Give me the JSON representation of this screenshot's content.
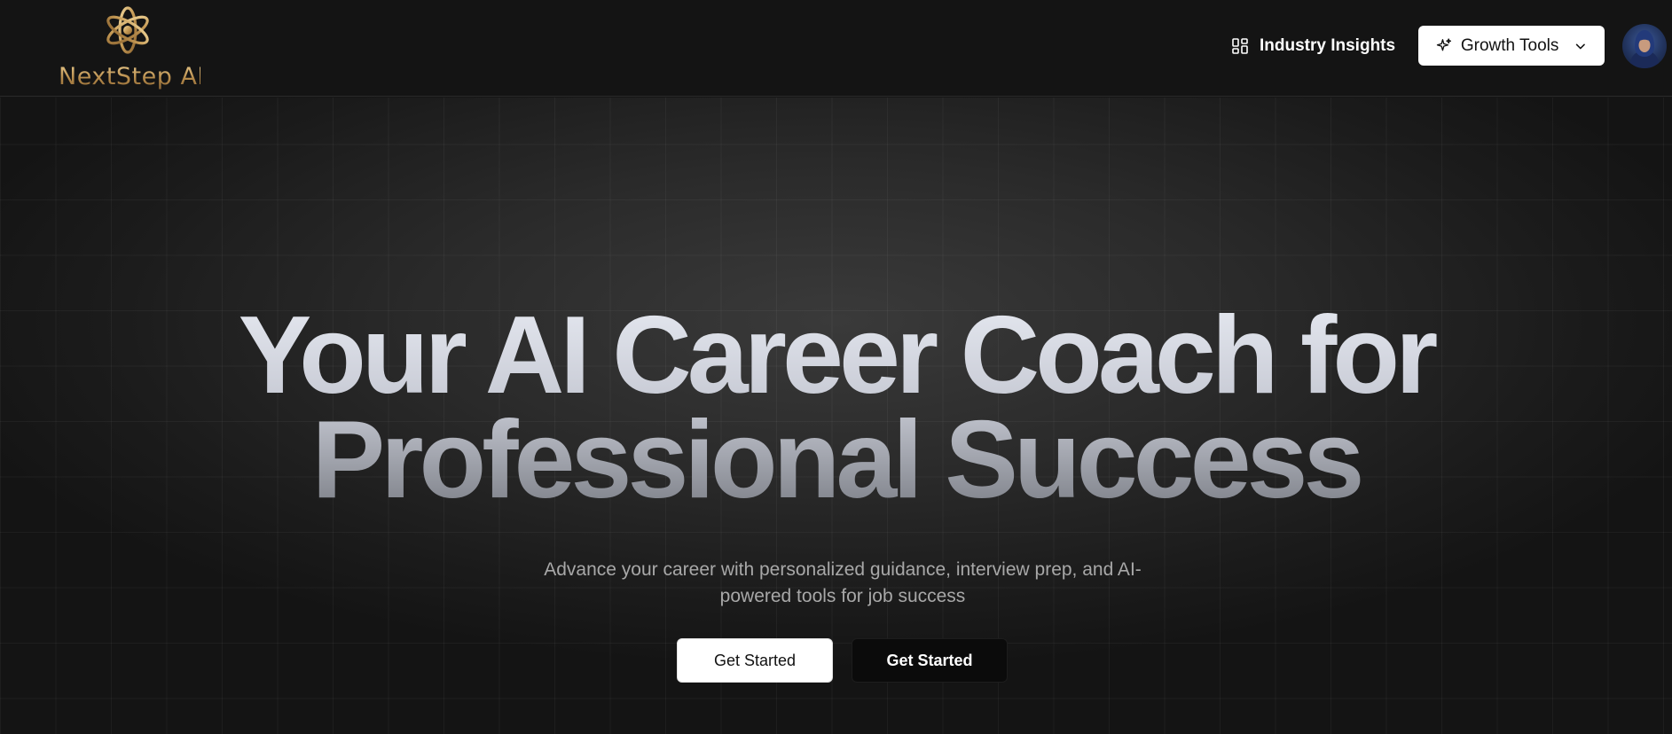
{
  "header": {
    "brand": "NextStep AI",
    "logo_icon": "flower-knot-icon",
    "nav": {
      "insights_label": "Industry Insights",
      "insights_icon": "dashboard-icon",
      "growth_label": "Growth Tools",
      "growth_icon": "sparkles-icon",
      "growth_chevron_icon": "chevron-down-icon"
    },
    "avatar_icon": "user-avatar"
  },
  "hero": {
    "title_line1": "Your AI Career Coach for",
    "title_line2": "Professional Success",
    "subtitle": "Advance your career with personalized guidance, interview prep, and AI-powered tools for job success",
    "cta_primary": "Get Started",
    "cta_secondary": "Get Started"
  },
  "colors": {
    "background": "#151515",
    "brand_gold": "#c9a263",
    "button_light": "#ffffff",
    "button_dark": "#0b0b0b"
  }
}
